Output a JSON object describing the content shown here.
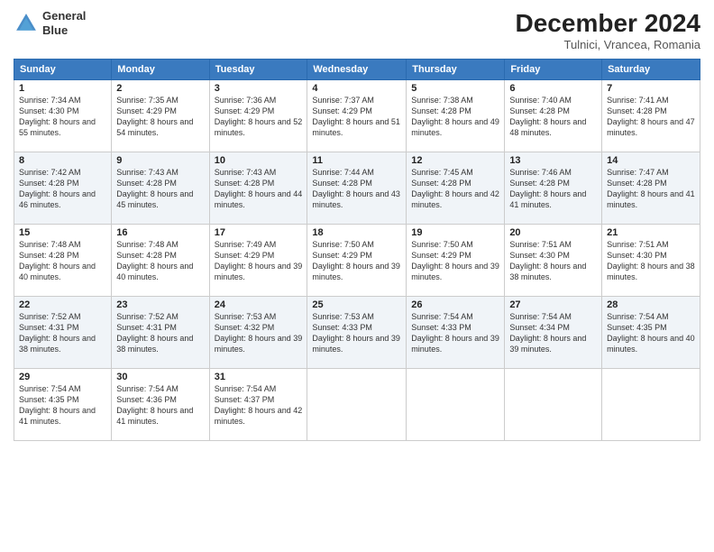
{
  "header": {
    "logo_line1": "General",
    "logo_line2": "Blue",
    "month": "December 2024",
    "location": "Tulnici, Vrancea, Romania"
  },
  "weekdays": [
    "Sunday",
    "Monday",
    "Tuesday",
    "Wednesday",
    "Thursday",
    "Friday",
    "Saturday"
  ],
  "weeks": [
    [
      {
        "day": "1",
        "sunrise": "Sunrise: 7:34 AM",
        "sunset": "Sunset: 4:30 PM",
        "daylight": "Daylight: 8 hours and 55 minutes."
      },
      {
        "day": "2",
        "sunrise": "Sunrise: 7:35 AM",
        "sunset": "Sunset: 4:29 PM",
        "daylight": "Daylight: 8 hours and 54 minutes."
      },
      {
        "day": "3",
        "sunrise": "Sunrise: 7:36 AM",
        "sunset": "Sunset: 4:29 PM",
        "daylight": "Daylight: 8 hours and 52 minutes."
      },
      {
        "day": "4",
        "sunrise": "Sunrise: 7:37 AM",
        "sunset": "Sunset: 4:29 PM",
        "daylight": "Daylight: 8 hours and 51 minutes."
      },
      {
        "day": "5",
        "sunrise": "Sunrise: 7:38 AM",
        "sunset": "Sunset: 4:28 PM",
        "daylight": "Daylight: 8 hours and 49 minutes."
      },
      {
        "day": "6",
        "sunrise": "Sunrise: 7:40 AM",
        "sunset": "Sunset: 4:28 PM",
        "daylight": "Daylight: 8 hours and 48 minutes."
      },
      {
        "day": "7",
        "sunrise": "Sunrise: 7:41 AM",
        "sunset": "Sunset: 4:28 PM",
        "daylight": "Daylight: 8 hours and 47 minutes."
      }
    ],
    [
      {
        "day": "8",
        "sunrise": "Sunrise: 7:42 AM",
        "sunset": "Sunset: 4:28 PM",
        "daylight": "Daylight: 8 hours and 46 minutes."
      },
      {
        "day": "9",
        "sunrise": "Sunrise: 7:43 AM",
        "sunset": "Sunset: 4:28 PM",
        "daylight": "Daylight: 8 hours and 45 minutes."
      },
      {
        "day": "10",
        "sunrise": "Sunrise: 7:43 AM",
        "sunset": "Sunset: 4:28 PM",
        "daylight": "Daylight: 8 hours and 44 minutes."
      },
      {
        "day": "11",
        "sunrise": "Sunrise: 7:44 AM",
        "sunset": "Sunset: 4:28 PM",
        "daylight": "Daylight: 8 hours and 43 minutes."
      },
      {
        "day": "12",
        "sunrise": "Sunrise: 7:45 AM",
        "sunset": "Sunset: 4:28 PM",
        "daylight": "Daylight: 8 hours and 42 minutes."
      },
      {
        "day": "13",
        "sunrise": "Sunrise: 7:46 AM",
        "sunset": "Sunset: 4:28 PM",
        "daylight": "Daylight: 8 hours and 41 minutes."
      },
      {
        "day": "14",
        "sunrise": "Sunrise: 7:47 AM",
        "sunset": "Sunset: 4:28 PM",
        "daylight": "Daylight: 8 hours and 41 minutes."
      }
    ],
    [
      {
        "day": "15",
        "sunrise": "Sunrise: 7:48 AM",
        "sunset": "Sunset: 4:28 PM",
        "daylight": "Daylight: 8 hours and 40 minutes."
      },
      {
        "day": "16",
        "sunrise": "Sunrise: 7:48 AM",
        "sunset": "Sunset: 4:28 PM",
        "daylight": "Daylight: 8 hours and 40 minutes."
      },
      {
        "day": "17",
        "sunrise": "Sunrise: 7:49 AM",
        "sunset": "Sunset: 4:29 PM",
        "daylight": "Daylight: 8 hours and 39 minutes."
      },
      {
        "day": "18",
        "sunrise": "Sunrise: 7:50 AM",
        "sunset": "Sunset: 4:29 PM",
        "daylight": "Daylight: 8 hours and 39 minutes."
      },
      {
        "day": "19",
        "sunrise": "Sunrise: 7:50 AM",
        "sunset": "Sunset: 4:29 PM",
        "daylight": "Daylight: 8 hours and 39 minutes."
      },
      {
        "day": "20",
        "sunrise": "Sunrise: 7:51 AM",
        "sunset": "Sunset: 4:30 PM",
        "daylight": "Daylight: 8 hours and 38 minutes."
      },
      {
        "day": "21",
        "sunrise": "Sunrise: 7:51 AM",
        "sunset": "Sunset: 4:30 PM",
        "daylight": "Daylight: 8 hours and 38 minutes."
      }
    ],
    [
      {
        "day": "22",
        "sunrise": "Sunrise: 7:52 AM",
        "sunset": "Sunset: 4:31 PM",
        "daylight": "Daylight: 8 hours and 38 minutes."
      },
      {
        "day": "23",
        "sunrise": "Sunrise: 7:52 AM",
        "sunset": "Sunset: 4:31 PM",
        "daylight": "Daylight: 8 hours and 38 minutes."
      },
      {
        "day": "24",
        "sunrise": "Sunrise: 7:53 AM",
        "sunset": "Sunset: 4:32 PM",
        "daylight": "Daylight: 8 hours and 39 minutes."
      },
      {
        "day": "25",
        "sunrise": "Sunrise: 7:53 AM",
        "sunset": "Sunset: 4:33 PM",
        "daylight": "Daylight: 8 hours and 39 minutes."
      },
      {
        "day": "26",
        "sunrise": "Sunrise: 7:54 AM",
        "sunset": "Sunset: 4:33 PM",
        "daylight": "Daylight: 8 hours and 39 minutes."
      },
      {
        "day": "27",
        "sunrise": "Sunrise: 7:54 AM",
        "sunset": "Sunset: 4:34 PM",
        "daylight": "Daylight: 8 hours and 39 minutes."
      },
      {
        "day": "28",
        "sunrise": "Sunrise: 7:54 AM",
        "sunset": "Sunset: 4:35 PM",
        "daylight": "Daylight: 8 hours and 40 minutes."
      }
    ],
    [
      {
        "day": "29",
        "sunrise": "Sunrise: 7:54 AM",
        "sunset": "Sunset: 4:35 PM",
        "daylight": "Daylight: 8 hours and 41 minutes."
      },
      {
        "day": "30",
        "sunrise": "Sunrise: 7:54 AM",
        "sunset": "Sunset: 4:36 PM",
        "daylight": "Daylight: 8 hours and 41 minutes."
      },
      {
        "day": "31",
        "sunrise": "Sunrise: 7:54 AM",
        "sunset": "Sunset: 4:37 PM",
        "daylight": "Daylight: 8 hours and 42 minutes."
      },
      null,
      null,
      null,
      null
    ]
  ]
}
